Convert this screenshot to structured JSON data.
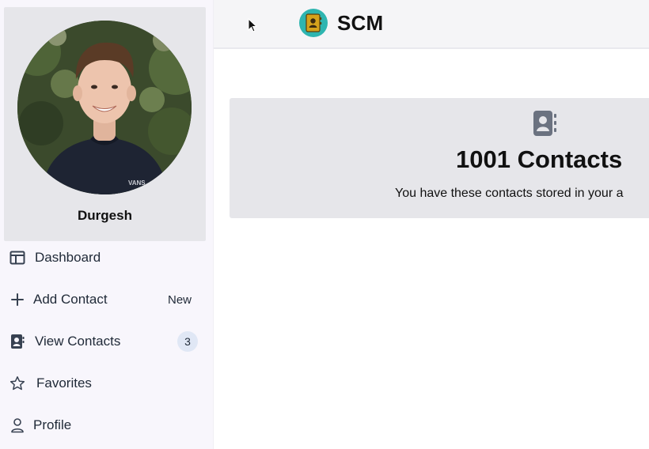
{
  "header": {
    "brand": "SCM"
  },
  "profile": {
    "name": "Durgesh"
  },
  "sidebar": {
    "items": [
      {
        "label": "Dashboard",
        "icon": "dashboard-icon"
      },
      {
        "label": "Add Contact",
        "icon": "plus-icon",
        "badge": "New"
      },
      {
        "label": "View Contacts",
        "icon": "contacts-icon",
        "count": "3"
      },
      {
        "label": "Favorites",
        "icon": "star-icon"
      },
      {
        "label": "Profile",
        "icon": "user-icon"
      }
    ]
  },
  "stats": {
    "count_label": "1001 Contacts",
    "description": "You have these contacts stored in your a"
  },
  "colors": {
    "sidebar_bg": "#f8f6fc",
    "card_bg": "#e6e6ea",
    "brand_logo": "#2eb5b0",
    "count_badge_bg": "#e0e7f5"
  }
}
